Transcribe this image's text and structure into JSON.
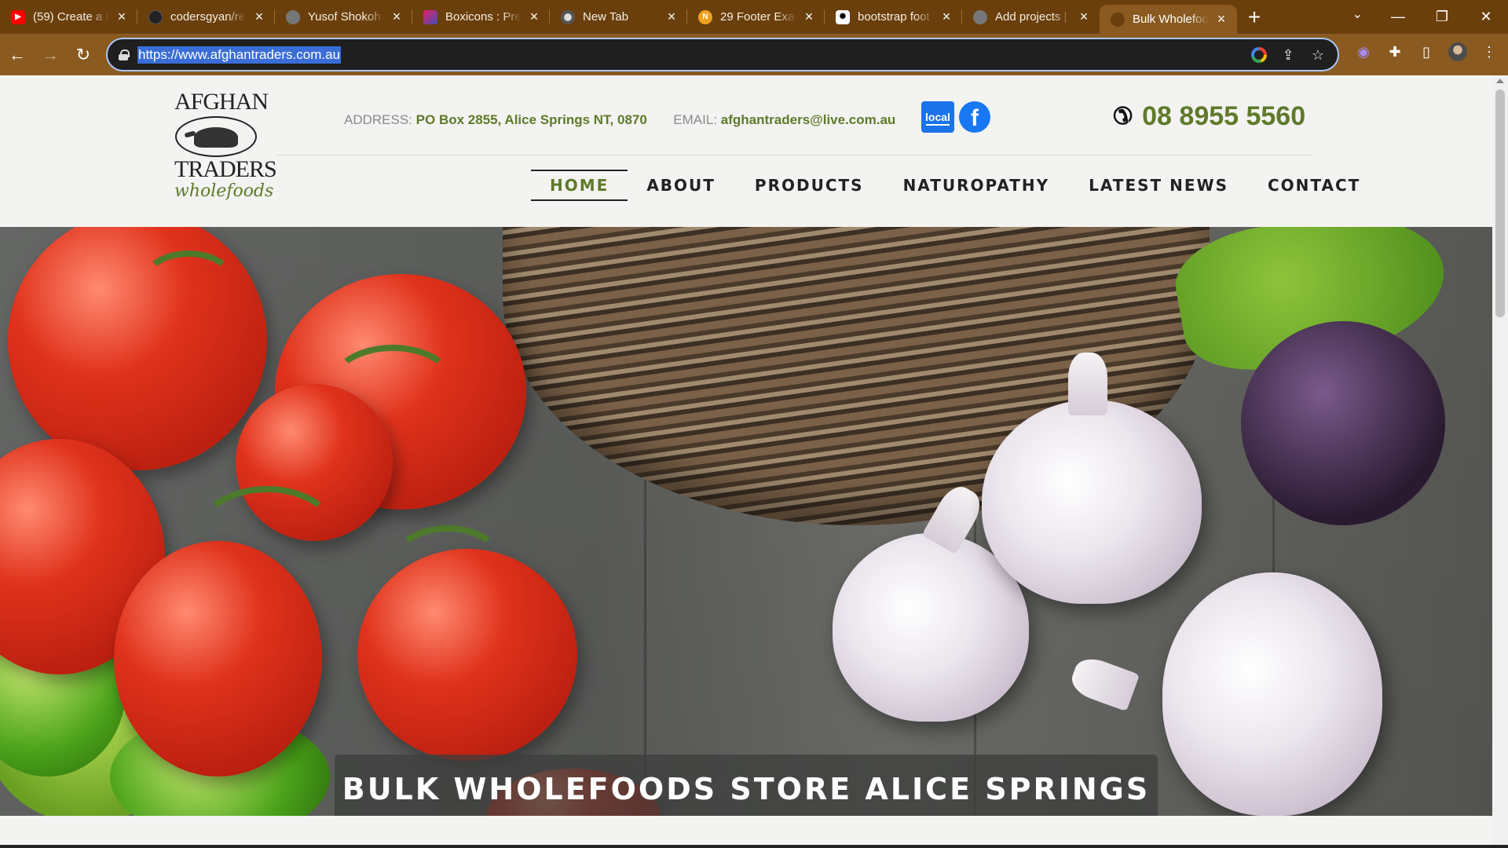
{
  "browser": {
    "tabs": [
      {
        "title": "(59) Create a F",
        "icon": "youtube-icon",
        "color": "#ff0000"
      },
      {
        "title": "codersgyan/re",
        "icon": "github-icon",
        "color": "#222222"
      },
      {
        "title": "Yusof Shokoh",
        "icon": "globe-icon",
        "color": "#777777"
      },
      {
        "title": "Boxicons : Prer",
        "icon": "boxicons-icon",
        "color": "#e91e63"
      },
      {
        "title": "New Tab",
        "icon": "profile-icon",
        "color": "#555555"
      },
      {
        "title": "29 Footer Exar",
        "icon": "site-icon",
        "color": "#f0a020"
      },
      {
        "title": "bootstrap foot",
        "icon": "openai-icon",
        "color": "#000000"
      },
      {
        "title": "Add projects |",
        "icon": "globe-icon",
        "color": "#777777"
      },
      {
        "title": "Bulk Wholefoo",
        "icon": "camel-icon",
        "color": "#8a5a20",
        "active": true
      }
    ],
    "url": "https://www.afghantraders.com.au"
  },
  "site": {
    "logo": {
      "line1": "AFGHAN",
      "line2": "TRADERS",
      "script": "wholefoods"
    },
    "address_label": "ADDRESS:",
    "address": "PO Box 2855, Alice Springs NT, 0870",
    "email_label": "EMAIL:",
    "email": "afghantraders@live.com.au",
    "local_badge": "local",
    "facebook": "f",
    "phone": "08 8955 5560",
    "nav": [
      "HOME",
      "ABOUT",
      "PRODUCTS",
      "NATUROPATHY",
      "LATEST NEWS",
      "CONTACT"
    ],
    "hero_caption": "BULK WHOLEFOODS STORE ALICE SPRINGS",
    "accent": "#5f7a2a"
  }
}
